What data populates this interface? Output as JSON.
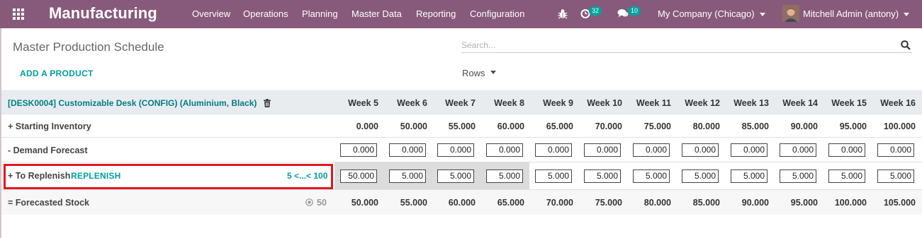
{
  "navbar": {
    "app_title": "Manufacturing",
    "menu": [
      "Overview",
      "Operations",
      "Planning",
      "Master Data",
      "Reporting",
      "Configuration"
    ],
    "activity_count": "32",
    "messages_count": "10",
    "company": "My Company (Chicago)",
    "user": "Mitchell Admin (antony)"
  },
  "control": {
    "page_title": "Master Production Schedule",
    "search_placeholder": "Search...",
    "add_product_label": "ADD A PRODUCT",
    "rows_label": "Rows"
  },
  "table": {
    "product": "[DESK0004] Customizable Desk (CONFIG) (Aluminium, Black)",
    "weeks": [
      "Week 5",
      "Week 6",
      "Week 7",
      "Week 8",
      "Week 9",
      "Week 10",
      "Week 11",
      "Week 12",
      "Week 13",
      "Week 14",
      "Week 15",
      "Week 16"
    ],
    "starting_inventory": {
      "label": "+ Starting Inventory",
      "values": [
        "0.000",
        "50.000",
        "55.000",
        "60.000",
        "65.000",
        "70.000",
        "75.000",
        "80.000",
        "85.000",
        "90.000",
        "95.000",
        "100.000"
      ]
    },
    "demand_forecast": {
      "label": "- Demand Forecast",
      "values": [
        "0.000",
        "0.000",
        "0.000",
        "0.000",
        "0.000",
        "0.000",
        "0.000",
        "0.000",
        "0.000",
        "0.000",
        "0.000",
        "0.000"
      ]
    },
    "to_replenish": {
      "label": "+ To Replenish",
      "replenish_label": "REPLENISH",
      "bounds": "5 <...< 100",
      "values": [
        "50.000",
        "5.000",
        "5.000",
        "5.000",
        "5.000",
        "5.000",
        "5.000",
        "5.000",
        "5.000",
        "5.000",
        "5.000",
        "5.000"
      ]
    },
    "forecasted_stock": {
      "label": "= Forecasted Stock",
      "safety_stock": "50",
      "values": [
        "50.000",
        "55.000",
        "60.000",
        "65.000",
        "70.000",
        "75.000",
        "80.000",
        "85.000",
        "90.000",
        "95.000",
        "100.000",
        "105.000"
      ]
    }
  },
  "colors": {
    "navbar": "#875a7b",
    "accent": "#00a09d",
    "product_link": "#017e84",
    "highlight_box": "#e3151e"
  }
}
